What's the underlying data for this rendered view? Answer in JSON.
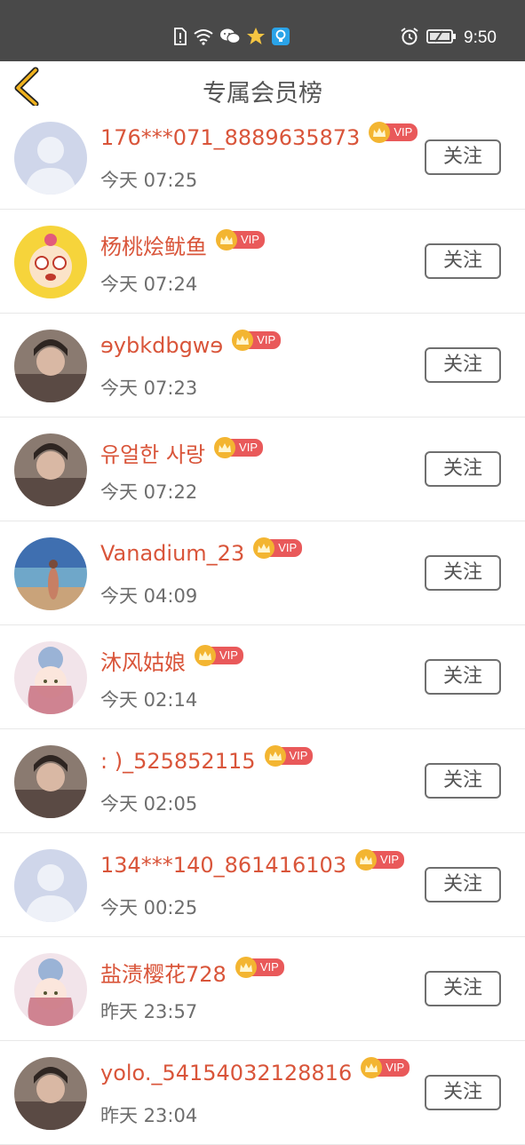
{
  "status_bar": {
    "time": "9:50",
    "icons": [
      "sim-alert-icon",
      "wifi-icon",
      "wechat-icon",
      "star-app-icon",
      "bulb-app-icon",
      "alarm-icon",
      "battery-icon"
    ]
  },
  "header": {
    "title": "专属会员榜"
  },
  "vip_label": "VIP",
  "follow_label": "关注",
  "colors": {
    "status_bar": "#494949",
    "accent_back": "#f0b21e",
    "username": "#d9553a",
    "vip_badge": "#e9595a",
    "crown": "#f3b531"
  },
  "members": [
    {
      "name": "176***071_8889635873",
      "time": "今天 07:25",
      "avatar": "default-avatar-icon"
    },
    {
      "name": "杨桃烩鱿鱼",
      "time": "今天 07:24",
      "avatar": "cartoon-avatar"
    },
    {
      "name": "ɘybkdbgwɘ",
      "time": "今天 07:23",
      "avatar": "photo-avatar"
    },
    {
      "name": "유얼한 사랑",
      "time": "今天 07:22",
      "avatar": "photo-avatar"
    },
    {
      "name": "Vanadium_23",
      "time": "今天 04:09",
      "avatar": "beach-photo-avatar"
    },
    {
      "name": "沐风姑娘",
      "time": "今天 02:14",
      "avatar": "illustration-avatar"
    },
    {
      "name": ": )_525852115",
      "time": "今天 02:05",
      "avatar": "photo-avatar"
    },
    {
      "name": "134***140_861416103",
      "time": "今天 00:25",
      "avatar": "default-avatar-icon"
    },
    {
      "name": "盐渍樱花728",
      "time": "昨天 23:57",
      "avatar": "illustration-avatar"
    },
    {
      "name": "yolo._54154032128816",
      "time": "昨天 23:04",
      "avatar": "photo-avatar"
    }
  ]
}
